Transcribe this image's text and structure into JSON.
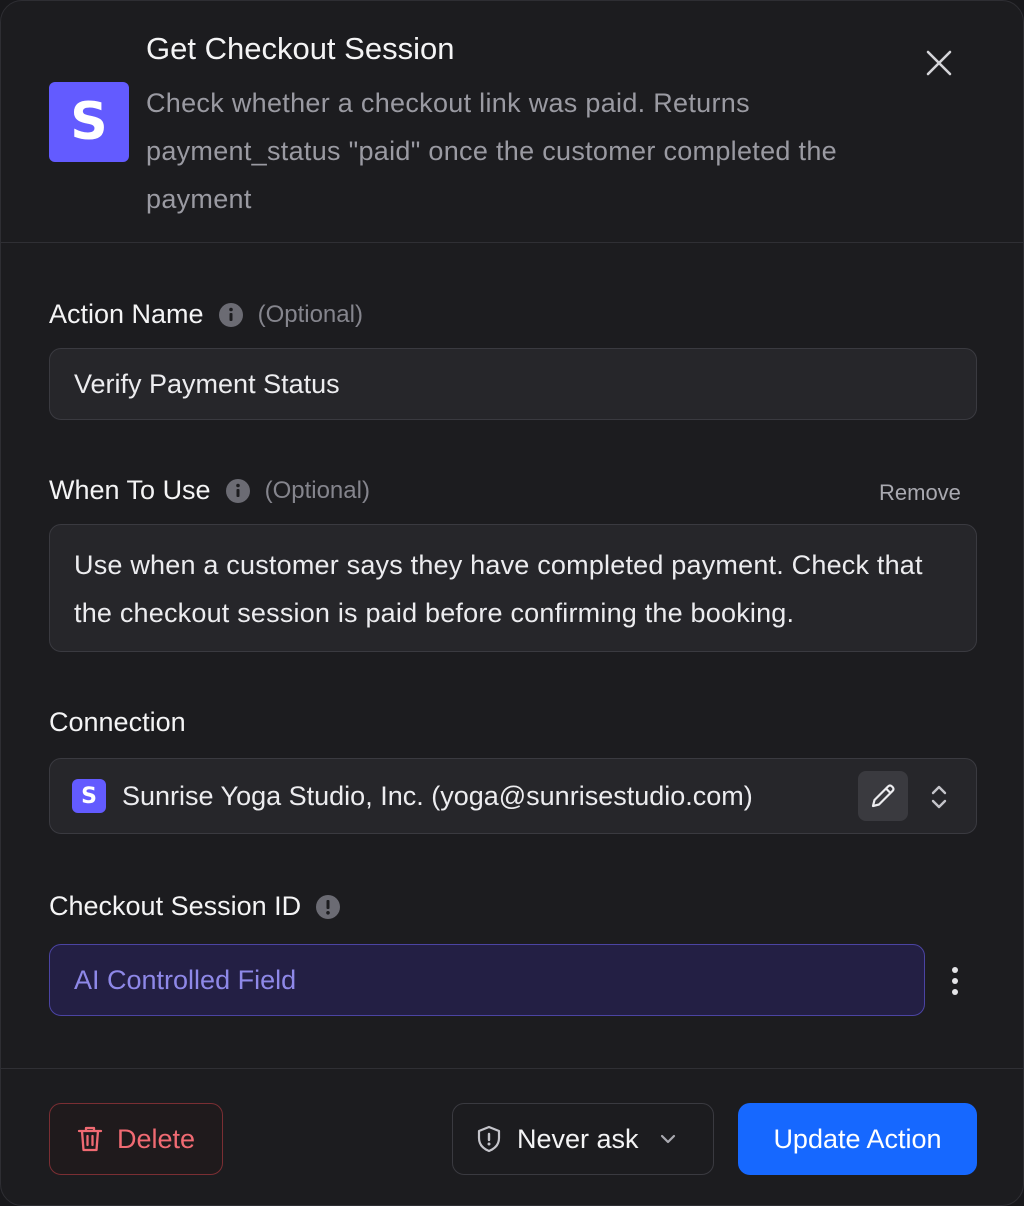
{
  "header": {
    "app_logo_letter": "S",
    "title": "Get Checkout Session",
    "description": "Check whether a checkout link was paid. Returns payment_status \"paid\" once the customer completed the payment",
    "close_icon": "close-icon"
  },
  "fields": {
    "action_name": {
      "label": "Action Name",
      "optional": "(Optional)",
      "value": "Verify Payment Status"
    },
    "when_to_use": {
      "label": "When To Use",
      "optional": "(Optional)",
      "remove_label": "Remove",
      "value": "Use when a customer says they have completed payment. Check that the checkout session is paid before confirming the booking."
    },
    "connection": {
      "label": "Connection",
      "logo_letter": "S",
      "value": "Sunrise Yoga Studio, Inc. (yoga@sunrisestudio.com)"
    },
    "checkout_session_id": {
      "label": "Checkout Session ID",
      "value": "AI Controlled Field"
    }
  },
  "footer": {
    "delete_label": "Delete",
    "approval_label": "Never ask",
    "update_label": "Update Action"
  },
  "colors": {
    "brand": "#635bff",
    "primary": "#1668ff",
    "danger": "#f06a72",
    "ai_field_bg": "#231f44"
  }
}
